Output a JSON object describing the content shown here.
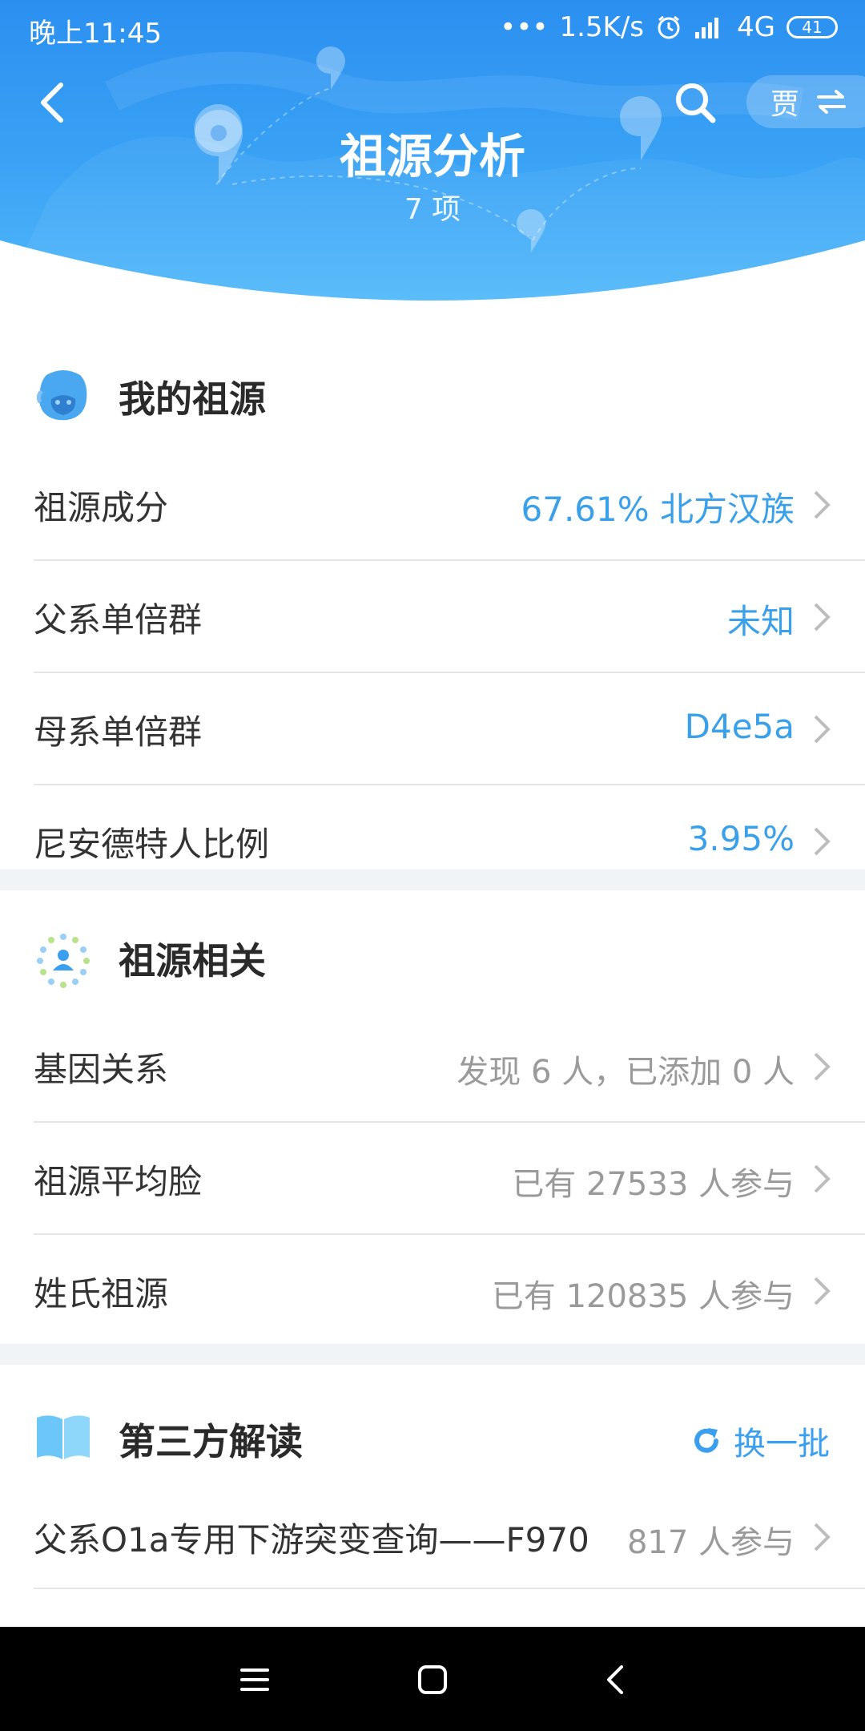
{
  "status": {
    "time": "晚上11:45",
    "speed": "1.5K/s",
    "network": "4G",
    "battery": "41"
  },
  "header": {
    "title": "祖源分析",
    "subtitle": "7 项",
    "switch_label": "贾"
  },
  "my_ancestry": {
    "title": "我的祖源",
    "rows": [
      {
        "label": "祖源成分",
        "value": "67.61% 北方汉族"
      },
      {
        "label": "父系单倍群",
        "value": "未知"
      },
      {
        "label": "母系单倍群",
        "value": "D4e5a"
      },
      {
        "label": "尼安德特人比例",
        "value": "3.95%"
      }
    ]
  },
  "related": {
    "title": "祖源相关",
    "rows": [
      {
        "label": "基因关系",
        "value": "发现 6 人，已添加 0 人"
      },
      {
        "label": "祖源平均脸",
        "value": "已有 27533 人参与"
      },
      {
        "label": "姓氏祖源",
        "value": "已有 120835 人参与"
      }
    ]
  },
  "third_party": {
    "title": "第三方解读",
    "refresh_label": "换一批",
    "rows": [
      {
        "label": "父系O1a专用下游突变查询——F970",
        "value": "817 人参与"
      }
    ]
  },
  "colors": {
    "accent": "#3aa0ea",
    "header_top": "#2b8ff0",
    "header_bottom": "#52b9fa",
    "section_gap": "#f1f4f7"
  }
}
